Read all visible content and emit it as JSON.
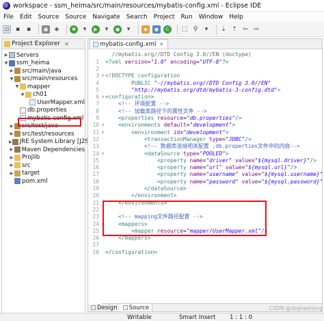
{
  "window": {
    "title": "workspace - ssm_heima/src/main/resources/mybatis-config.xml - Eclipse IDE"
  },
  "menu": [
    "File",
    "Edit",
    "Source",
    "Source",
    "Navigate",
    "Search",
    "Project",
    "Run",
    "Window",
    "Help"
  ],
  "project_explorer": {
    "title": "Project Explorer",
    "items": [
      {
        "label": "Servers",
        "depth": 0,
        "icon": "server-folder-icon",
        "twisty": ">"
      },
      {
        "label": "ssm_heima",
        "depth": 0,
        "icon": "project-icon",
        "twisty": "v"
      },
      {
        "label": "src/main/java",
        "depth": 1,
        "icon": "source-folder-icon",
        "twisty": ">"
      },
      {
        "label": "src/main/resources",
        "depth": 1,
        "icon": "source-folder-icon",
        "twisty": "v"
      },
      {
        "label": "mapper",
        "depth": 2,
        "icon": "folder-icon",
        "twisty": "v"
      },
      {
        "label": "ch01",
        "depth": 3,
        "icon": "folder-icon",
        "twisty": "v"
      },
      {
        "label": "UserMapper.xml",
        "depth": 4,
        "icon": "xml-file-icon",
        "twisty": ""
      },
      {
        "label": "db.properties",
        "depth": 2,
        "icon": "file-icon",
        "twisty": ""
      },
      {
        "label": "mybatis-config.xml",
        "depth": 2,
        "icon": "xml-file-icon",
        "twisty": ""
      },
      {
        "label": "src/test/java",
        "depth": 1,
        "icon": "source-folder-icon",
        "twisty": ">"
      },
      {
        "label": "src/test/resources",
        "depth": 1,
        "icon": "source-folder-icon",
        "twisty": ">"
      },
      {
        "label": "JRE System Library [J2SE-",
        "depth": 1,
        "icon": "library-icon",
        "twisty": ">"
      },
      {
        "label": "Maven Dependencies",
        "depth": 1,
        "icon": "library-icon",
        "twisty": ">"
      },
      {
        "label": "Projlib",
        "depth": 1,
        "icon": "folder-icon",
        "twisty": ">"
      },
      {
        "label": "src",
        "depth": 1,
        "icon": "folder-icon",
        "twisty": ">"
      },
      {
        "label": "target",
        "depth": 1,
        "icon": "target-folder-icon",
        "twisty": ">"
      },
      {
        "label": "pom.xml",
        "depth": 1,
        "icon": "maven-pom-icon",
        "twisty": ""
      }
    ]
  },
  "editor": {
    "tab_label": "mybatis-config.xml",
    "header_hint": "  //mybatis.org//DTD Config 3.0//EN (doctype)",
    "lines": [
      {
        "n": "1",
        "fold": "",
        "tokens": [
          {
            "t": "<?",
            "c": "t-pun"
          },
          {
            "t": "xml ",
            "c": "t-tag"
          },
          {
            "t": "version",
            "c": "t-attr"
          },
          {
            "t": "=",
            "c": "ct"
          },
          {
            "t": "\"1.0\"",
            "c": "t-val"
          },
          {
            "t": " encoding",
            "c": "t-attr"
          },
          {
            "t": "=",
            "c": "ct"
          },
          {
            "t": "\"UTF-8\"",
            "c": "t-val"
          },
          {
            "t": "?>",
            "c": "t-pun"
          }
        ]
      },
      {
        "n": "2",
        "fold": "",
        "tokens": []
      },
      {
        "n": "3",
        "fold": "⊖",
        "tokens": [
          {
            "t": "<!DOCTYPE configuration",
            "c": "t-tag"
          }
        ]
      },
      {
        "n": "4",
        "fold": "",
        "tokens": [
          {
            "t": "        PUBLIC ",
            "c": "t-tag"
          },
          {
            "t": "\"-//mybatis.org//DTD Config 3.0//EN\"",
            "c": "t-val"
          }
        ]
      },
      {
        "n": "5",
        "fold": "",
        "tokens": [
          {
            "t": "        ",
            "c": "ct"
          },
          {
            "t": "\"http://mybatis.org/dtd/mybatis-3-config.dtd\"",
            "c": "t-val"
          },
          {
            "t": ">",
            "c": "t-tag"
          }
        ]
      },
      {
        "n": "6",
        "fold": "⊖",
        "tokens": [
          {
            "t": "<",
            "c": "t-pun"
          },
          {
            "t": "configuration",
            "c": "t-tag"
          },
          {
            "t": ">",
            "c": "t-pun"
          }
        ]
      },
      {
        "n": "7",
        "fold": "",
        "tokens": [
          {
            "t": "    ",
            "c": "ct"
          },
          {
            "t": "<!-- 环境配置 -->",
            "c": "t-com"
          }
        ]
      },
      {
        "n": "8",
        "fold": "",
        "tokens": [
          {
            "t": "    ",
            "c": "ct"
          },
          {
            "t": "<!-- 加载类路径下的属性文件 -->",
            "c": "t-com"
          }
        ]
      },
      {
        "n": "9",
        "fold": "",
        "tokens": [
          {
            "t": "    ",
            "c": "ct"
          },
          {
            "t": "<",
            "c": "t-pun"
          },
          {
            "t": "properties ",
            "c": "t-tag"
          },
          {
            "t": "resource",
            "c": "t-attr"
          },
          {
            "t": "=",
            "c": "ct"
          },
          {
            "t": "\"db.properties\"",
            "c": "t-val"
          },
          {
            "t": "/>",
            "c": "t-pun"
          }
        ]
      },
      {
        "n": "10",
        "fold": "⊖",
        "tokens": [
          {
            "t": "    ",
            "c": "ct"
          },
          {
            "t": "<",
            "c": "t-pun"
          },
          {
            "t": "environments ",
            "c": "t-tag"
          },
          {
            "t": "default",
            "c": "t-attr"
          },
          {
            "t": "=",
            "c": "ct"
          },
          {
            "t": "\"development\"",
            "c": "t-val"
          },
          {
            "t": ">",
            "c": "t-pun"
          }
        ]
      },
      {
        "n": "11",
        "fold": "⊖",
        "tokens": [
          {
            "t": "        ",
            "c": "ct"
          },
          {
            "t": "<",
            "c": "t-pun"
          },
          {
            "t": "environment ",
            "c": "t-tag"
          },
          {
            "t": "id",
            "c": "t-attr"
          },
          {
            "t": "=",
            "c": "ct"
          },
          {
            "t": "\"development\"",
            "c": "t-val"
          },
          {
            "t": ">",
            "c": "t-pun"
          }
        ]
      },
      {
        "n": "12",
        "fold": "",
        "tokens": [
          {
            "t": "            ",
            "c": "ct"
          },
          {
            "t": "<",
            "c": "t-pun"
          },
          {
            "t": "transactionManager ",
            "c": "t-tag"
          },
          {
            "t": "type",
            "c": "t-attr"
          },
          {
            "t": "=",
            "c": "ct"
          },
          {
            "t": "\"JDBC\"",
            "c": "t-val"
          },
          {
            "t": "/>",
            "c": "t-pun"
          }
        ]
      },
      {
        "n": "13",
        "fold": "",
        "tokens": [
          {
            "t": "            ",
            "c": "ct"
          },
          {
            "t": "<!-- 数据库连接相关配置 ,db.properties文件中的内容-->",
            "c": "t-com"
          }
        ]
      },
      {
        "n": "14",
        "fold": "⊖",
        "tokens": [
          {
            "t": "            ",
            "c": "ct"
          },
          {
            "t": "<",
            "c": "t-pun"
          },
          {
            "t": "dataSource ",
            "c": "t-tag"
          },
          {
            "t": "type",
            "c": "t-attr"
          },
          {
            "t": "=",
            "c": "ct"
          },
          {
            "t": "\"POOLED\"",
            "c": "t-val"
          },
          {
            "t": ">",
            "c": "t-pun"
          }
        ]
      },
      {
        "n": "15",
        "fold": "",
        "tokens": [
          {
            "t": "                ",
            "c": "ct"
          },
          {
            "t": "<",
            "c": "t-pun"
          },
          {
            "t": "property ",
            "c": "t-tag"
          },
          {
            "t": "name",
            "c": "t-attr"
          },
          {
            "t": "=",
            "c": "ct"
          },
          {
            "t": "\"driver\"",
            "c": "t-val"
          },
          {
            "t": " value",
            "c": "t-attr"
          },
          {
            "t": "=",
            "c": "ct"
          },
          {
            "t": "\"${mysql.driver}\"",
            "c": "t-val"
          },
          {
            "t": "/>",
            "c": "t-pun"
          }
        ]
      },
      {
        "n": "16",
        "fold": "",
        "tokens": [
          {
            "t": "                ",
            "c": "ct"
          },
          {
            "t": "<",
            "c": "t-pun"
          },
          {
            "t": "property ",
            "c": "t-tag"
          },
          {
            "t": "name",
            "c": "t-attr"
          },
          {
            "t": "=",
            "c": "ct"
          },
          {
            "t": "\"url\"",
            "c": "t-val"
          },
          {
            "t": " value",
            "c": "t-attr"
          },
          {
            "t": "=",
            "c": "ct"
          },
          {
            "t": "\"${mysql.url}\"",
            "c": "t-val"
          },
          {
            "t": "/>",
            "c": "t-pun"
          }
        ]
      },
      {
        "n": "17",
        "fold": "",
        "tokens": [
          {
            "t": "                ",
            "c": "ct"
          },
          {
            "t": "<",
            "c": "t-pun"
          },
          {
            "t": "property ",
            "c": "t-tag"
          },
          {
            "t": "name",
            "c": "t-attr"
          },
          {
            "t": "=",
            "c": "ct"
          },
          {
            "t": "\"username\"",
            "c": "t-val"
          },
          {
            "t": " value",
            "c": "t-attr"
          },
          {
            "t": "=",
            "c": "ct"
          },
          {
            "t": "\"${mysql.username}\"",
            "c": "t-val"
          },
          {
            "t": "/>",
            "c": "t-pun"
          }
        ]
      },
      {
        "n": "18",
        "fold": "",
        "tokens": [
          {
            "t": "                ",
            "c": "ct"
          },
          {
            "t": "<",
            "c": "t-pun"
          },
          {
            "t": "property ",
            "c": "t-tag"
          },
          {
            "t": "name",
            "c": "t-attr"
          },
          {
            "t": "=",
            "c": "ct"
          },
          {
            "t": "\"password\"",
            "c": "t-val"
          },
          {
            "t": " value",
            "c": "t-attr"
          },
          {
            "t": "=",
            "c": "ct"
          },
          {
            "t": "\"${mysql.password}\"",
            "c": "t-val"
          },
          {
            "t": "/>",
            "c": "t-pun"
          }
        ]
      },
      {
        "n": "19",
        "fold": "",
        "tokens": [
          {
            "t": "            ",
            "c": "ct"
          },
          {
            "t": "</",
            "c": "t-pun"
          },
          {
            "t": "dataSource",
            "c": "t-tag"
          },
          {
            "t": ">",
            "c": "t-pun"
          }
        ]
      },
      {
        "n": "20",
        "fold": "",
        "tokens": [
          {
            "t": "        ",
            "c": "ct"
          },
          {
            "t": "</",
            "c": "t-pun"
          },
          {
            "t": "environment",
            "c": "t-tag"
          },
          {
            "t": ">",
            "c": "t-pun"
          }
        ]
      },
      {
        "n": "21",
        "fold": "",
        "tokens": [
          {
            "t": "    ",
            "c": "ct"
          },
          {
            "t": "</",
            "c": "t-pun"
          },
          {
            "t": "environments",
            "c": "t-tag"
          },
          {
            "t": ">",
            "c": "t-pun"
          }
        ]
      },
      {
        "n": "22",
        "fold": "",
        "tokens": []
      },
      {
        "n": "23",
        "fold": "",
        "tokens": [
          {
            "t": "    ",
            "c": "ct"
          },
          {
            "t": "<!-- mapping文件路径配置 -->",
            "c": "t-com"
          }
        ]
      },
      {
        "n": "24",
        "fold": "⊖",
        "tokens": [
          {
            "t": "    ",
            "c": "ct"
          },
          {
            "t": "<",
            "c": "t-pun"
          },
          {
            "t": "mappers",
            "c": "t-tag"
          },
          {
            "t": ">",
            "c": "t-pun"
          }
        ]
      },
      {
        "n": "25",
        "fold": "",
        "tokens": [
          {
            "t": "        ",
            "c": "ct"
          },
          {
            "t": "<",
            "c": "t-pun"
          },
          {
            "t": "mapper ",
            "c": "t-tag"
          },
          {
            "t": "resource",
            "c": "t-attr"
          },
          {
            "t": "=",
            "c": "ct"
          },
          {
            "t": "\"mapper/UserMapper.xml\"",
            "c": "t-val"
          },
          {
            "t": "/>",
            "c": "t-pun"
          }
        ]
      },
      {
        "n": "26",
        "fold": "",
        "tokens": [
          {
            "t": "    ",
            "c": "ct"
          },
          {
            "t": "</",
            "c": "t-pun"
          },
          {
            "t": "mappers",
            "c": "t-tag"
          },
          {
            "t": ">",
            "c": "t-pun"
          }
        ]
      },
      {
        "n": "27",
        "fold": "",
        "tokens": []
      },
      {
        "n": "28",
        "fold": "",
        "tokens": [
          {
            "t": "</",
            "c": "t-pun"
          },
          {
            "t": "configuration",
            "c": "t-tag"
          },
          {
            "t": ">",
            "c": "t-pun"
          }
        ]
      }
    ]
  },
  "bottom_tabs": {
    "design": "Design",
    "source": "Source"
  },
  "status": {
    "mode": "Writable",
    "insert": "Smart Insert",
    "position": "1 : 1 : 0"
  },
  "watermark": "CSDN @zbqliwenjing",
  "colors": {
    "highlight_box": "#e8101d",
    "tag": "#3f7f7f",
    "attribute": "#7f007f",
    "value": "#2a00ff",
    "comment": "#3f5fbf"
  }
}
